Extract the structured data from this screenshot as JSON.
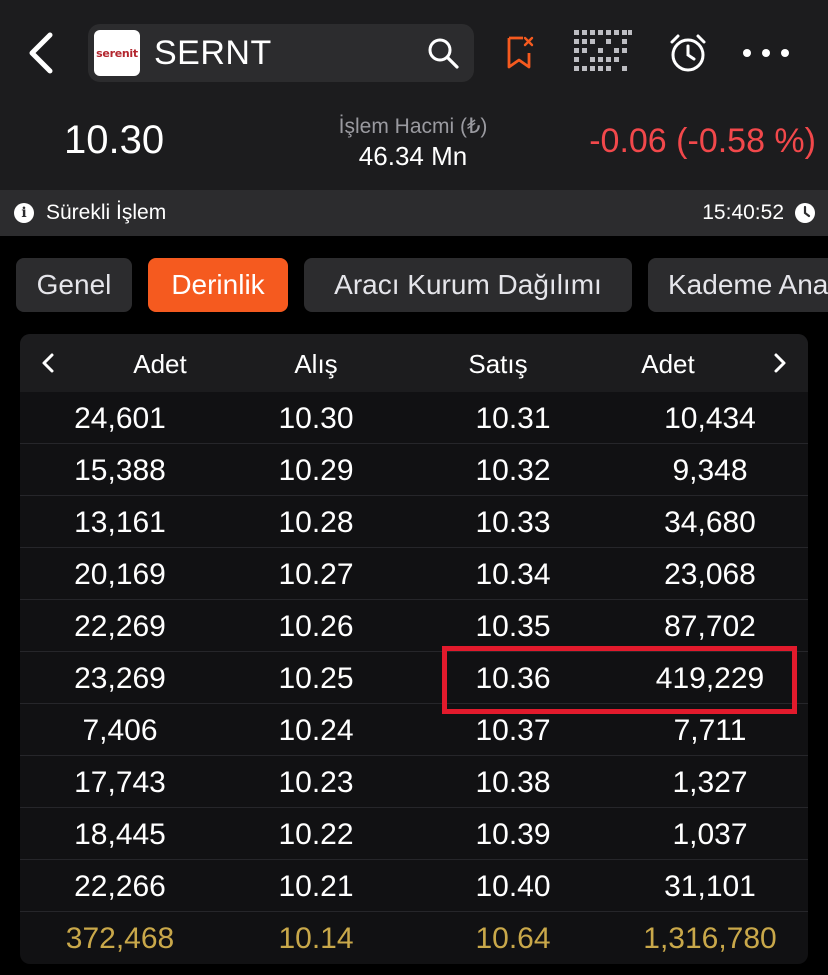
{
  "header": {
    "logo_text": "serenit",
    "symbol": "SERNT",
    "price": "10.30",
    "volume_label": "İşlem Hacmi (₺)",
    "volume_value": "46.34 Mn",
    "change": "-0.06",
    "change_pct": "(-0.58 %)"
  },
  "status": {
    "label": "Sürekli İşlem",
    "time": "15:40:52"
  },
  "tabs": [
    {
      "label": "Genel"
    },
    {
      "label": "Derinlik"
    },
    {
      "label": "Aracı Kurum Dağılımı"
    },
    {
      "label": "Kademe Analizi"
    }
  ],
  "depth": {
    "headers": {
      "bid_qty": "Adet",
      "bid": "Alış",
      "ask": "Satış",
      "ask_qty": "Adet"
    },
    "rows": [
      {
        "bid_qty": "24,601",
        "bid": "10.30",
        "ask": "10.31",
        "ask_qty": "10,434"
      },
      {
        "bid_qty": "15,388",
        "bid": "10.29",
        "ask": "10.32",
        "ask_qty": "9,348"
      },
      {
        "bid_qty": "13,161",
        "bid": "10.28",
        "ask": "10.33",
        "ask_qty": "34,680"
      },
      {
        "bid_qty": "20,169",
        "bid": "10.27",
        "ask": "10.34",
        "ask_qty": "23,068"
      },
      {
        "bid_qty": "22,269",
        "bid": "10.26",
        "ask": "10.35",
        "ask_qty": "87,702"
      },
      {
        "bid_qty": "23,269",
        "bid": "10.25",
        "ask": "10.36",
        "ask_qty": "419,229"
      },
      {
        "bid_qty": "7,406",
        "bid": "10.24",
        "ask": "10.37",
        "ask_qty": "7,711"
      },
      {
        "bid_qty": "17,743",
        "bid": "10.23",
        "ask": "10.38",
        "ask_qty": "1,327"
      },
      {
        "bid_qty": "18,445",
        "bid": "10.22",
        "ask": "10.39",
        "ask_qty": "1,037"
      },
      {
        "bid_qty": "22,266",
        "bid": "10.21",
        "ask": "10.40",
        "ask_qty": "31,101"
      }
    ],
    "totals": {
      "bid_qty": "372,468",
      "bid": "10.14",
      "ask": "10.64",
      "ask_qty": "1,316,780"
    }
  },
  "colors": {
    "accent": "#f55a1f",
    "negative": "#f2484b",
    "total": "#c9a84a",
    "highlight_box": "#e21a2c"
  }
}
